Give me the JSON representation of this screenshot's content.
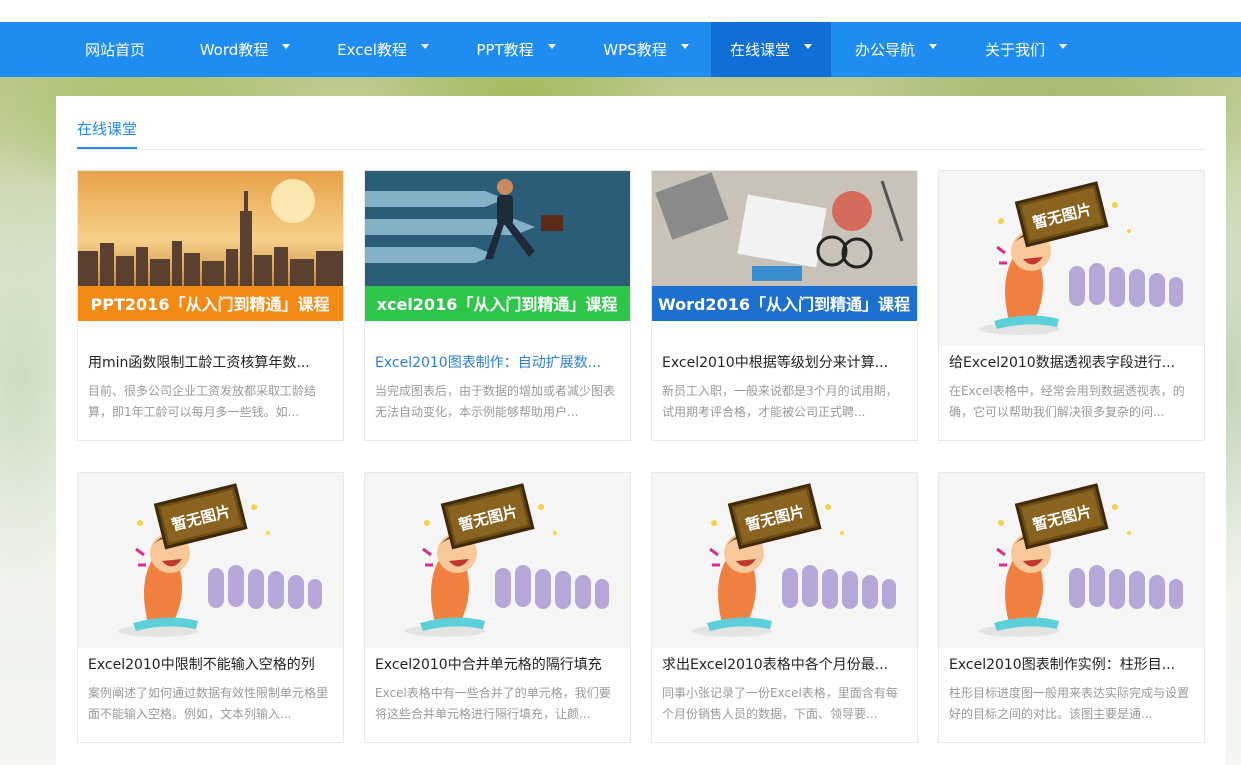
{
  "nav": {
    "items": [
      {
        "label": "网站首页",
        "dropdown": false,
        "active": false
      },
      {
        "label": "Word教程",
        "dropdown": true,
        "active": false
      },
      {
        "label": "Excel教程",
        "dropdown": true,
        "active": false
      },
      {
        "label": "PPT教程",
        "dropdown": true,
        "active": false
      },
      {
        "label": "WPS教程",
        "dropdown": true,
        "active": false
      },
      {
        "label": "在线课堂",
        "dropdown": true,
        "active": true
      },
      {
        "label": "办公导航",
        "dropdown": true,
        "active": false
      },
      {
        "label": "关于我们",
        "dropdown": true,
        "active": false
      }
    ],
    "color": "#1e8cf0",
    "active_color": "#0f6fd6"
  },
  "section": {
    "title": "在线课堂"
  },
  "cards": [
    {
      "banner": "PPT2016「从入门到精通」课程",
      "banner_color": "#f28a14",
      "title": "用min函数限制工龄工资核算年数...",
      "desc": "目前、很多公司企业工资发放都采取工龄结算，即1年工龄可以每月多一些钱。如...",
      "link": false
    },
    {
      "banner": "xcel2016「从入门到精通」课程",
      "banner_color": "#2fc44a",
      "title": "Excel2010图表制作：自动扩展数...",
      "desc": "当完成图表后，由于数据的增加或者减少图表无法自动变化，本示例能够帮助用户...",
      "link": true
    },
    {
      "banner": "Word2016「从入门到精通」课程",
      "banner_color": "#1d6fd0",
      "title": "Excel2010中根据等级划分来计算...",
      "desc": "新员工入职，一般来说都是3个月的试用期，试用期考评合格，才能被公司正式聘...",
      "link": false
    },
    {
      "banner": "暂无图片",
      "banner_color": "",
      "title": "给Excel2010数据透视表字段进行...",
      "desc": "在Excel表格中，经常会用到数据透视表，的确，它可以帮助我们解决很多复杂的问...",
      "link": false
    },
    {
      "banner": "暂无图片",
      "banner_color": "",
      "title": "Excel2010中限制不能输入空格的列",
      "desc": "案例阐述了如何通过数据有效性限制单元格里面不能输入空格。例如，文本列输入...",
      "link": false
    },
    {
      "banner": "暂无图片",
      "banner_color": "",
      "title": "Excel2010中合并单元格的隔行填充",
      "desc": "Excel表格中有一些合并了的单元格，我们要将这些合并单元格进行隔行填充，让颜...",
      "link": false
    },
    {
      "banner": "暂无图片",
      "banner_color": "",
      "title": "求出Excel2010表格中各个月份最...",
      "desc": "同事小张记录了一份Excel表格，里面含有每个月份销售人员的数据，下面、领导要...",
      "link": false
    },
    {
      "banner": "暂无图片",
      "banner_color": "",
      "title": "Excel2010图表制作实例：柱形目...",
      "desc": "柱形目标进度图一般用来表达实际完成与设置好的目标之间的对比。该图主要是通...",
      "link": false
    }
  ]
}
